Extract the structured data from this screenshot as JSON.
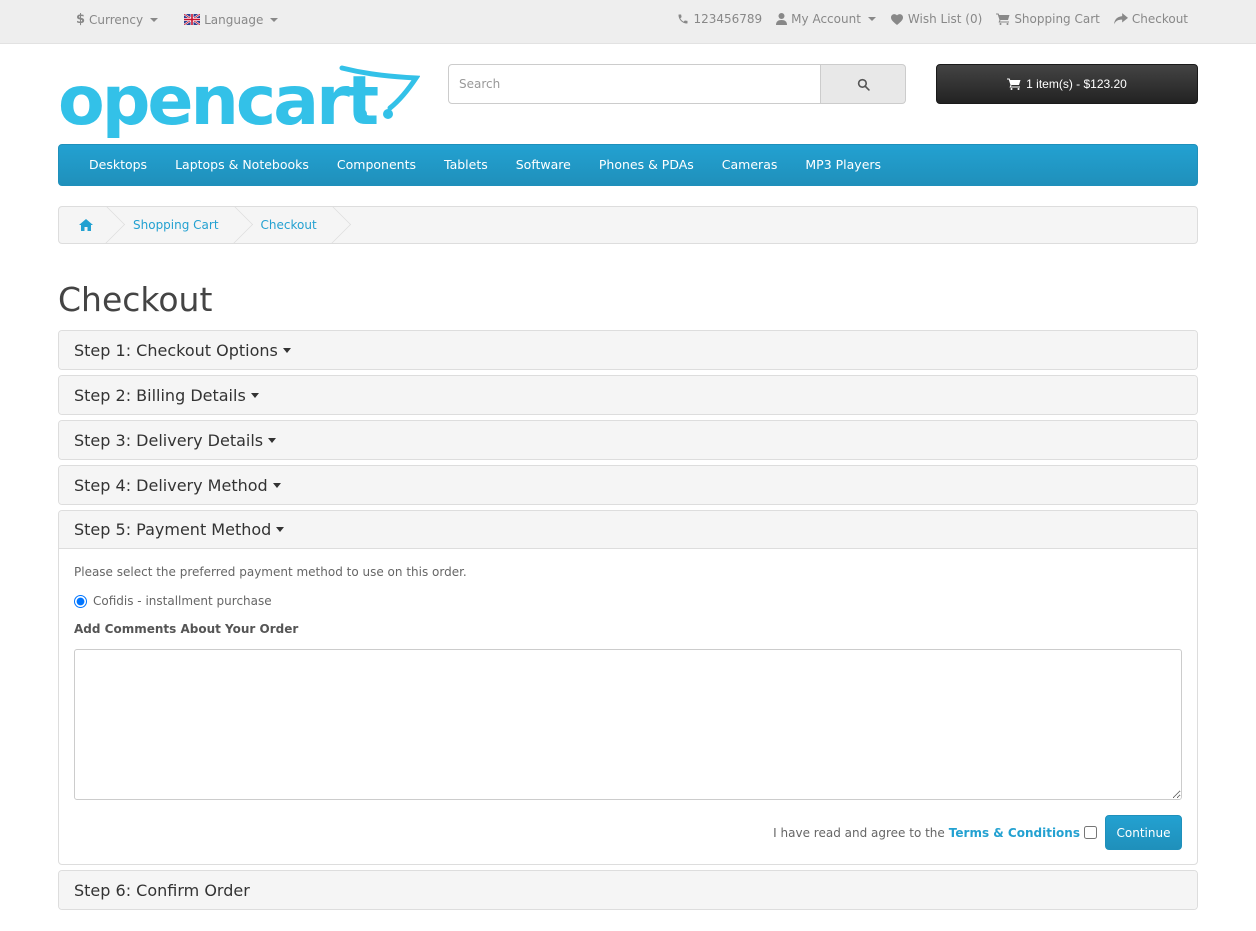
{
  "topbar": {
    "currency_label": "Currency",
    "language_label": "Language",
    "phone": "123456789",
    "my_account": "My Account",
    "wish_list": "Wish List (0)",
    "shopping_cart": "Shopping Cart",
    "checkout": "Checkout"
  },
  "header": {
    "logo_text": "opencart",
    "search_placeholder": "Search",
    "cart_button": "1 item(s) - $123.20"
  },
  "menu": {
    "items": [
      "Desktops",
      "Laptops & Notebooks",
      "Components",
      "Tablets",
      "Software",
      "Phones & PDAs",
      "Cameras",
      "MP3 Players"
    ]
  },
  "breadcrumb": {
    "items": [
      "Shopping Cart",
      "Checkout"
    ]
  },
  "page": {
    "title": "Checkout"
  },
  "steps": [
    {
      "label": "Step 1: Checkout Options"
    },
    {
      "label": "Step 2: Billing Details"
    },
    {
      "label": "Step 3: Delivery Details"
    },
    {
      "label": "Step 4: Delivery Method"
    },
    {
      "label": "Step 5: Payment Method"
    },
    {
      "label": "Step 6: Confirm Order"
    }
  ],
  "payment": {
    "info": "Please select the preferred payment method to use on this order.",
    "method_label": "Cofidis - installment purchase",
    "comments_label": "Add Comments About Your Order",
    "comments_value": "",
    "agree_text": "I have read and agree to the",
    "terms_link": "Terms & Conditions",
    "continue_label": "Continue"
  },
  "colors": {
    "accent": "#23a1d1",
    "logo": "#33c1e8",
    "cart_button": "#303030"
  }
}
